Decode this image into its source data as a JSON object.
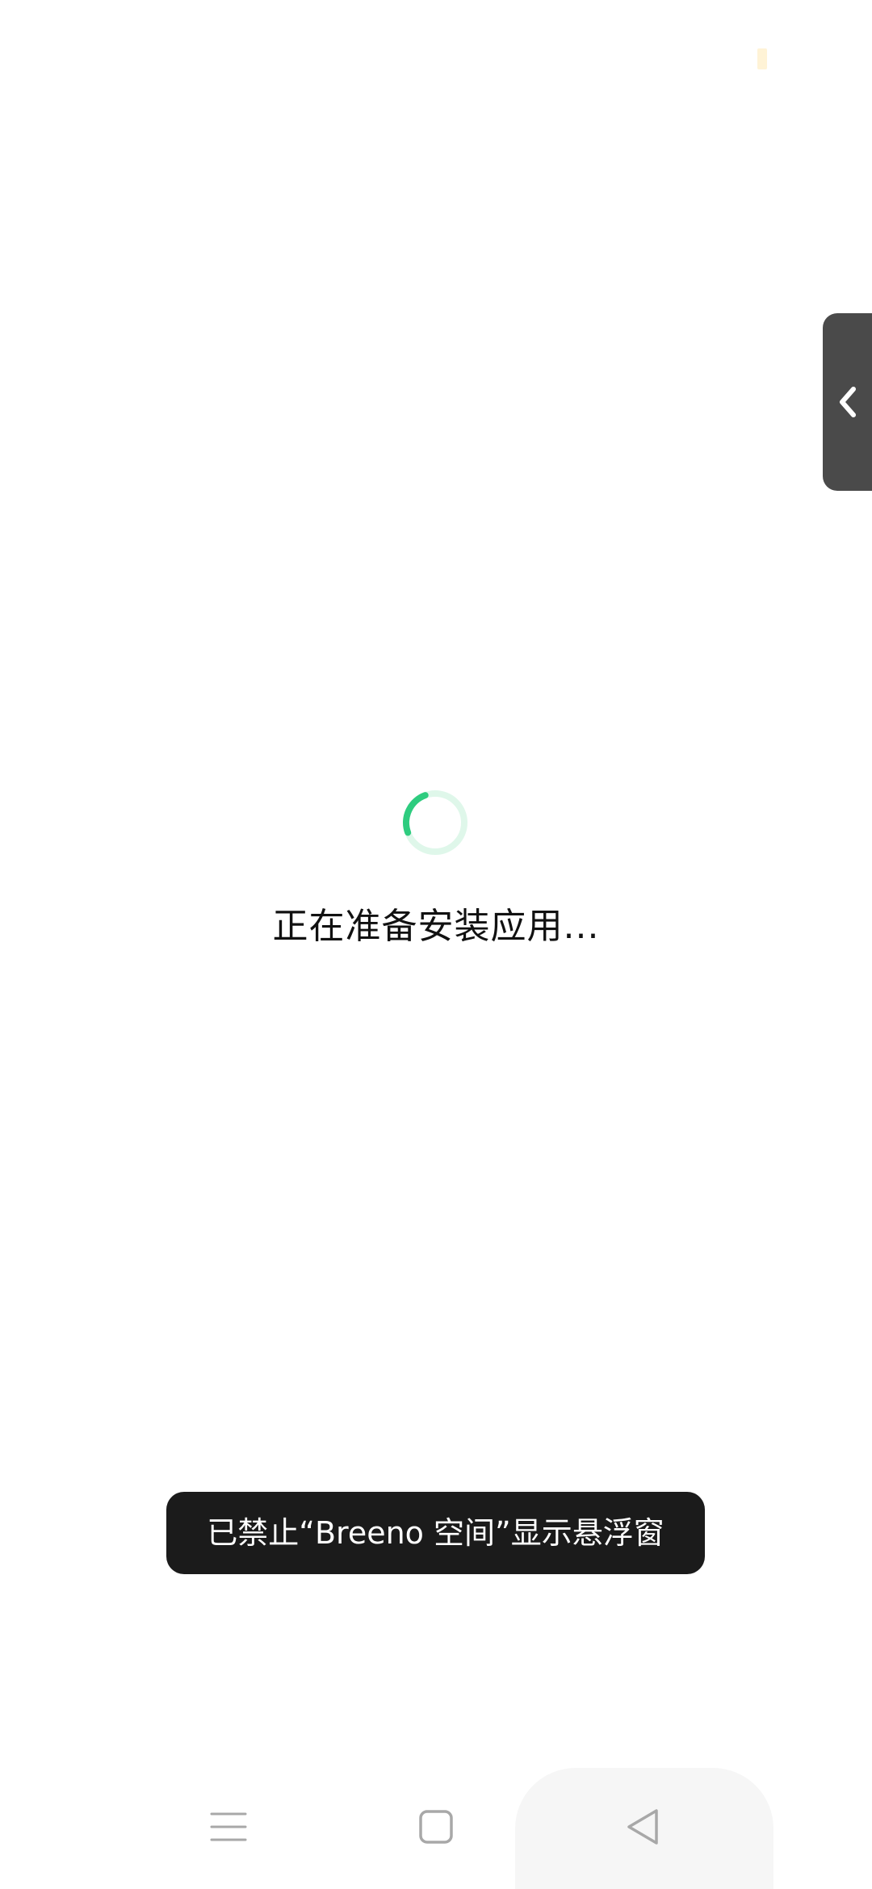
{
  "status": {
    "indicator_color": "#fff3d6"
  },
  "side_panel": {
    "icon": "chevron-left-icon",
    "background": "#4a4a4a"
  },
  "installer": {
    "loading_text": "正在准备安装应用...",
    "spinner_color": "#2ecc7f",
    "spinner_track_color": "#dff7ea"
  },
  "toast": {
    "message": "已禁止“Breeno 空间”显示悬浮窗"
  },
  "nav": {
    "menu_icon": "menu-icon",
    "home_icon": "home-icon",
    "back_icon": "back-icon"
  }
}
